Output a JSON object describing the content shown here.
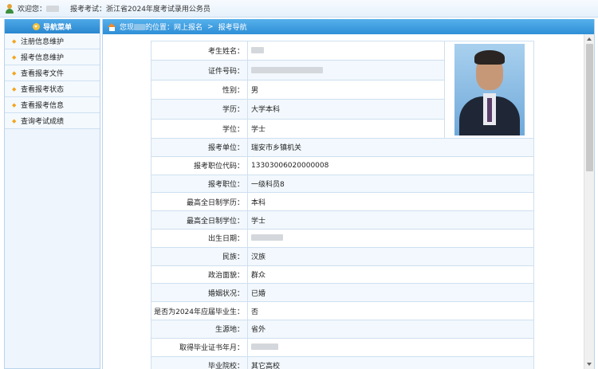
{
  "topbar": {
    "welcome_label": "欢迎您：",
    "exam_label": "报考考试：浙江省2024年度考试录用公务员"
  },
  "sidebar": {
    "title": "导航菜单",
    "items": [
      {
        "label": "注册信息维护"
      },
      {
        "label": "报考信息维护"
      },
      {
        "label": "查看报考文件"
      },
      {
        "label": "查看报考状态"
      },
      {
        "label": "查看报考信息"
      },
      {
        "label": "查询考试成绩"
      }
    ]
  },
  "breadcrumb": {
    "prefix": "您现",
    "suffix": "的位置：网上报名",
    "sep": ">",
    "current": "报考导航"
  },
  "form": {
    "rows": [
      {
        "label": "考生姓名：",
        "value": ""
      },
      {
        "label": "证件号码：",
        "value": ""
      },
      {
        "label": "性别：",
        "value": "男"
      },
      {
        "label": "学历：",
        "value": "大学本科"
      },
      {
        "label": "学位：",
        "value": "学士"
      },
      {
        "label": "报考单位：",
        "value": "瑞安市乡镇机关"
      },
      {
        "label": "报考职位代码：",
        "value": "13303006020000008"
      },
      {
        "label": "报考职位：",
        "value": "一级科员8"
      },
      {
        "label": "最高全日制学历：",
        "value": "本科"
      },
      {
        "label": "最高全日制学位：",
        "value": "学士"
      },
      {
        "label": "出生日期：",
        "value": ""
      },
      {
        "label": "民族：",
        "value": "汉族"
      },
      {
        "label": "政治面貌：",
        "value": "群众"
      },
      {
        "label": "婚姻状况：",
        "value": "已婚"
      },
      {
        "label": "是否为2024年应届毕业生：",
        "value": "否"
      },
      {
        "label": "生源地：",
        "value": "省外"
      },
      {
        "label": "取得毕业证书年月：",
        "value": ""
      },
      {
        "label": "毕业院校：",
        "value": "其它高校"
      }
    ]
  },
  "colors": {
    "accent": "#2f8fd6",
    "nav_bg": "#eef5fc",
    "border": "#cfe0f0"
  }
}
